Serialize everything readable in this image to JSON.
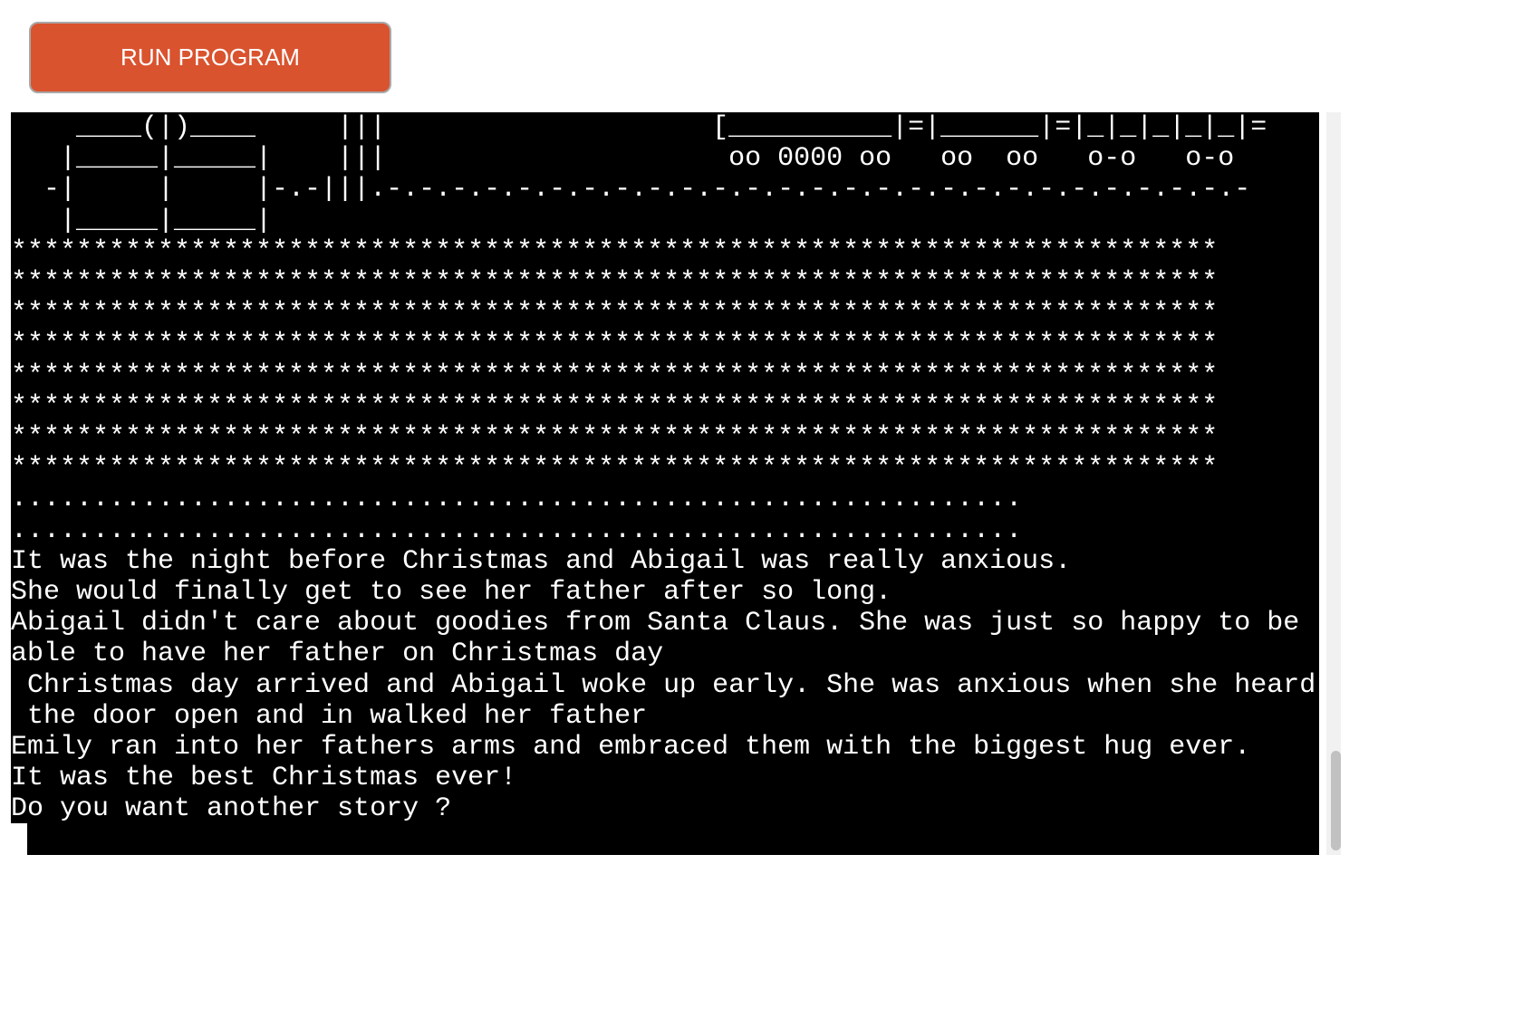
{
  "toolbar": {
    "run_label": "RUN PROGRAM"
  },
  "terminal": {
    "output": "    ____(|)____     |||                    [__________|=|______|=|_|_|_|_|_|=\n   |_____|_____|    |||                     oo 0000 oo   oo  oo   o-o   o-o\n  -|     |     |-.-|||.-.-.-.-.-.-.-.-.-.-.-.-.-.-.-.-.-.-.-.-.-.-.-.-.-.-.-\n   |_____|_____|\n**************************************************************************\n**************************************************************************\n**************************************************************************\n**************************************************************************\n**************************************************************************\n**************************************************************************\n**************************************************************************\n**************************************************************************\n..............................................................\n..............................................................\nIt was the night before Christmas and Abigail was really anxious.\nShe would finally get to see her father after so long.\nAbigail didn't care about goodies from Santa Claus. She was just so happy to be\nable to have her father on Christmas day\n Christmas day arrived and Abigail woke up early. She was anxious when she heard\n the door open and in walked her father\nEmily ran into her fathers arms and embraced them with the biggest hug ever.\nIt was the best Christmas ever!\nDo you want another story ?"
  },
  "colors": {
    "button_bg": "#d9532f",
    "terminal_bg": "#000000",
    "terminal_fg": "#ffffff"
  }
}
